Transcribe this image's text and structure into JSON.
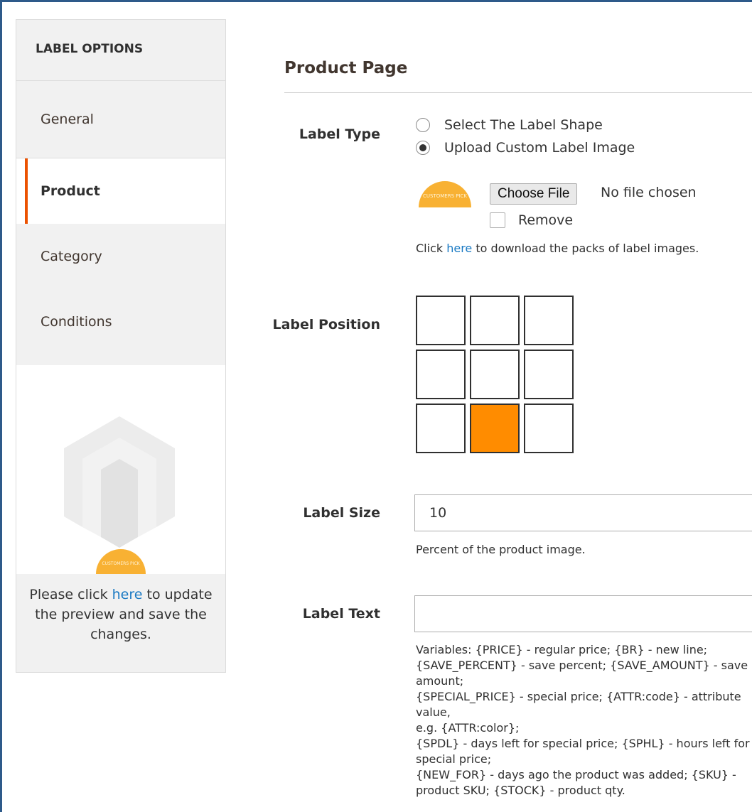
{
  "sidebar": {
    "title": "LABEL OPTIONS",
    "items": [
      {
        "label": "General"
      },
      {
        "label": "Product"
      },
      {
        "label": "Category"
      },
      {
        "label": "Conditions"
      }
    ],
    "preview": {
      "badge_text": "CUSTOMERS PICK",
      "note_before": "Please click ",
      "note_link": "here",
      "note_after": " to update the preview and save the changes."
    }
  },
  "main": {
    "section_title": "Product Page",
    "label_type": {
      "label": "Label Type",
      "options": [
        {
          "label": "Select The Label Shape",
          "checked": false
        },
        {
          "label": "Upload Custom Label Image",
          "checked": true
        }
      ],
      "thumb_text": "CUSTOMERS PICK",
      "choose_file_label": "Choose File",
      "file_status": "No file chosen",
      "remove_label": "Remove",
      "download_before": "Click ",
      "download_link": "here",
      "download_after": " to download the packs of label images."
    },
    "label_position": {
      "label": "Label Position",
      "selected": "bottom-center"
    },
    "label_size": {
      "label": "Label Size",
      "value": "10",
      "hint": "Percent of the product image."
    },
    "label_text": {
      "label": "Label Text",
      "value": "",
      "vars": [
        "Variables: {PRICE} - regular price; {BR} - new line;",
        "{SAVE_PERCENT} - save percent; {SAVE_AMOUNT} - save",
        "amount;",
        "{SPECIAL_PRICE} - special price; {ATTR:code} - attribute value,",
        "e.g. {ATTR:color};",
        "{SPDL} - days left for special price; {SPHL} - hours left for",
        "special price;",
        "{NEW_FOR} - days ago the product was added; {SKU} -",
        "product SKU; {STOCK} - product qty."
      ]
    }
  },
  "colors": {
    "accent": "#eb5202",
    "selected_cell": "#ff8c00",
    "link": "#1979c3",
    "badge": "#f8b133"
  }
}
